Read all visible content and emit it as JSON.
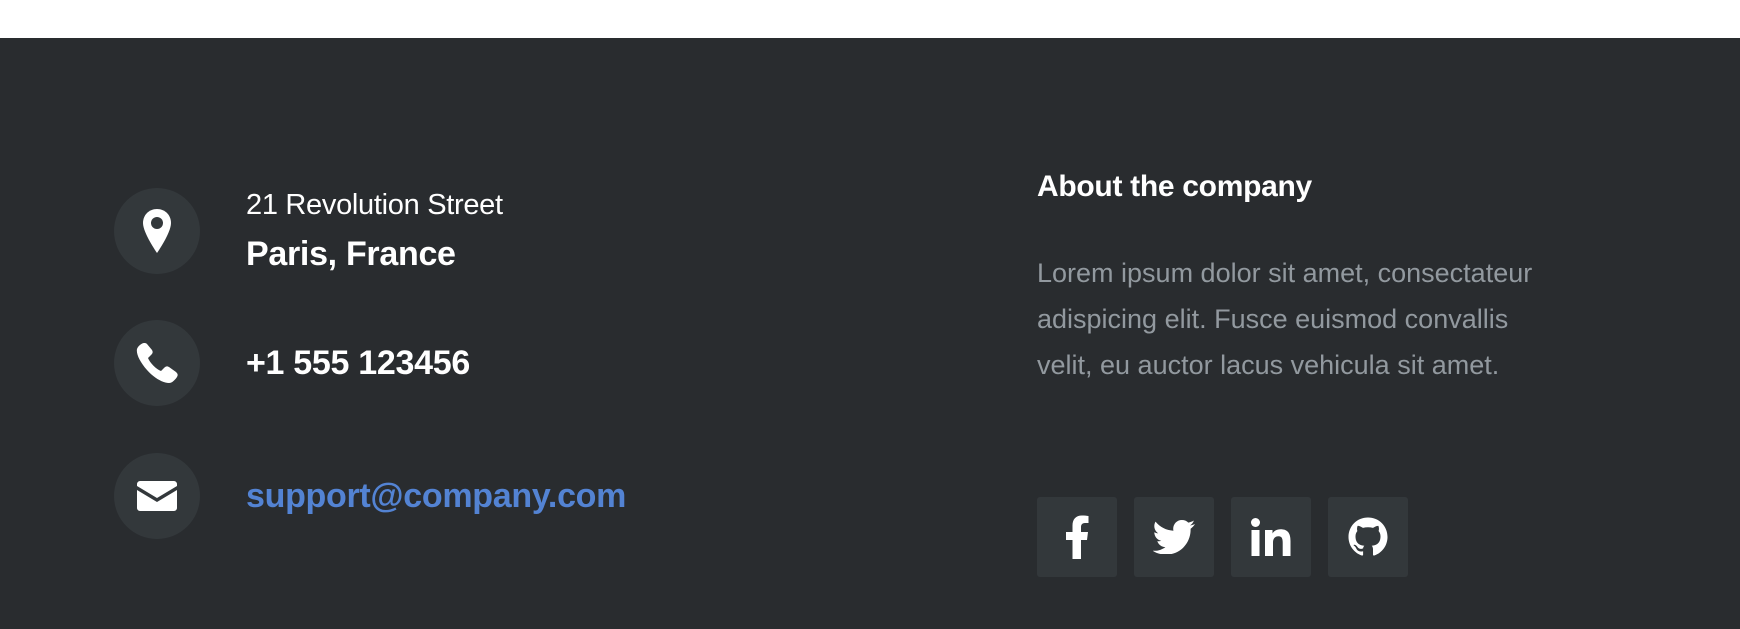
{
  "footer": {
    "address": {
      "street": "21 Revolution Street",
      "city": "Paris, France",
      "icon": "map-marker-icon"
    },
    "phone": {
      "number": "+1 555 123456",
      "icon": "phone-icon"
    },
    "email": {
      "address": "support@company.com",
      "icon": "envelope-icon"
    },
    "about": {
      "title": "About the company",
      "text": "Lorem ipsum dolor sit amet, consectateur adispicing elit. Fusce euismod convallis velit, eu auctor lacus vehicula sit amet."
    },
    "social": [
      {
        "icon": "facebook-icon"
      },
      {
        "icon": "twitter-icon"
      },
      {
        "icon": "linkedin-icon"
      },
      {
        "icon": "github-icon"
      }
    ]
  },
  "colors": {
    "background": "#292c2f",
    "icon_bg": "#33383b",
    "link": "#5383d3",
    "muted_text": "#92999f",
    "text": "#ffffff"
  }
}
